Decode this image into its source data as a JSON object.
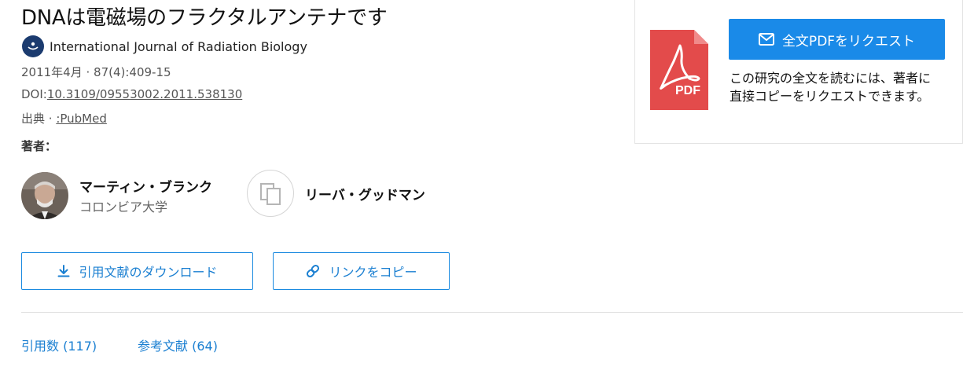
{
  "article": {
    "title": "DNAは電磁場のフラクタルアンテナです",
    "journal": "International Journal of Radiation Biology",
    "date_volume": "2011年4月 · 87(4):409-15",
    "doi_label": "DOI:",
    "doi": "10.3109/09553002.2011.538130",
    "source_label": "出典 · ",
    "source": ":PubMed"
  },
  "authors": {
    "label": "著者：",
    "list": [
      {
        "name": "マーティン・ブランク",
        "affiliation": "コロンビア大学"
      },
      {
        "name": "リーバ・グッドマン"
      }
    ]
  },
  "actions": {
    "download_citation": "引用文献のダウンロード",
    "copy_link": "リンクをコピー"
  },
  "tabs": {
    "citations": "引用数 (117)",
    "references": "参考文献 (64)"
  },
  "pdf_panel": {
    "request_button": "全文PDFをリクエスト",
    "icon_text": "PDF",
    "description": "この研究の全文を読むには、著者に直接コピーをリクエストできます。"
  },
  "colors": {
    "link_blue": "#1a7fd1",
    "button_blue": "#1a8ae8",
    "pdf_red": "#e34b4b"
  }
}
